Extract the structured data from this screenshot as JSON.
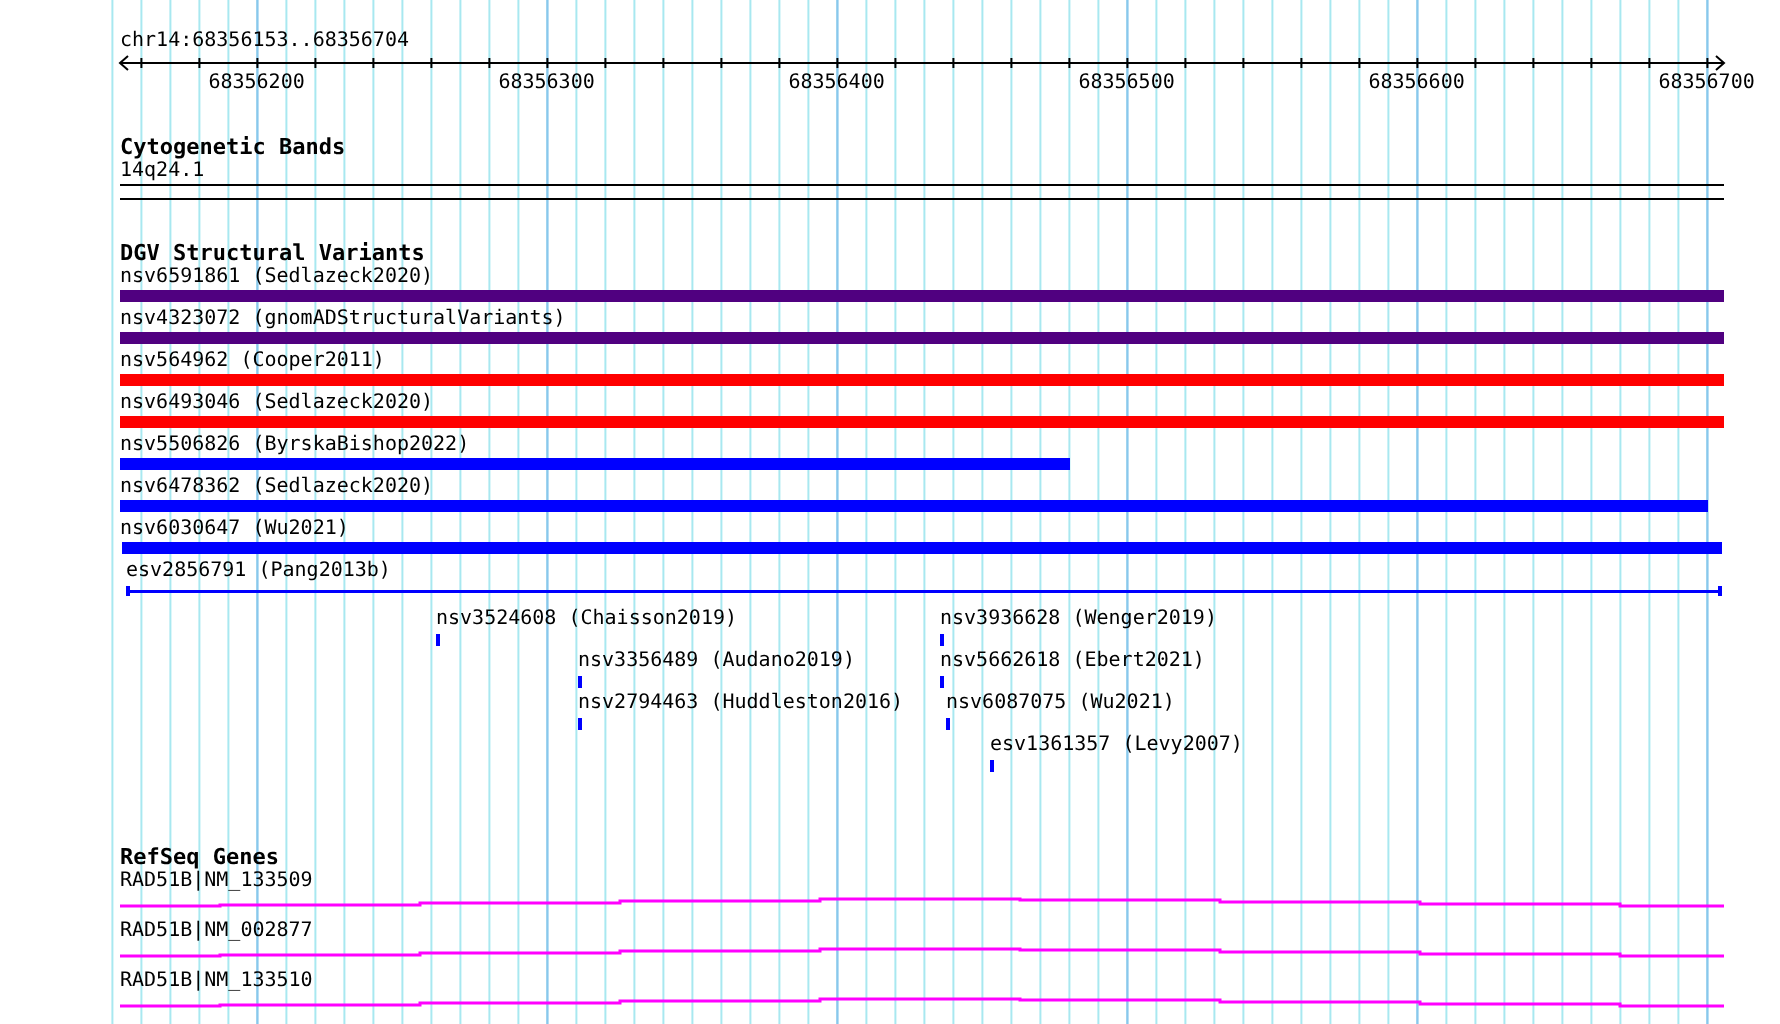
{
  "ruler": {
    "location": "chr14:68356153..68356704",
    "ticks": [
      "68356200",
      "68356300",
      "68356400",
      "68356500",
      "68356600",
      "68356700"
    ]
  },
  "tracks": [
    {
      "kind": "bands",
      "title": "Cytogenetic Bands",
      "features": [
        {
          "label": "14q24.1"
        }
      ]
    },
    {
      "kind": "variants",
      "title": "DGV Structural Variants",
      "features": [
        {
          "kind": "bar",
          "label": "nsv6591861 (Sedlazeck2020)",
          "color": "#500080"
        },
        {
          "kind": "bar",
          "label": "nsv4323072 (gnomADStructuralVariants)",
          "color": "#500080"
        },
        {
          "kind": "bar",
          "label": "nsv564962 (Cooper2011)",
          "color": "#ff0000"
        },
        {
          "kind": "bar",
          "label": "nsv6493046 (Sedlazeck2020)",
          "color": "#ff0000"
        },
        {
          "kind": "bar",
          "label": "nsv5506826 (ByrskaBishop2022)",
          "color": "#0000ff"
        },
        {
          "kind": "bar",
          "label": "nsv6478362 (Sedlazeck2020)",
          "color": "#0000ff"
        },
        {
          "kind": "bar",
          "label": "nsv6030647 (Wu2021)",
          "color": "#0000ff"
        },
        {
          "kind": "line",
          "label": "esv2856791 (Pang2013b)",
          "color": "#0000ff"
        },
        {
          "kind": "tick",
          "label": "nsv3524608 (Chaisson2019)",
          "color": "#0000ff"
        },
        {
          "kind": "tick",
          "label": "nsv3356489 (Audano2019)",
          "color": "#0000ff"
        },
        {
          "kind": "tick",
          "label": "nsv2794463 (Huddleston2016)",
          "color": "#0000ff"
        },
        {
          "kind": "tick",
          "label": "nsv3936628 (Wenger2019)",
          "color": "#0000ff"
        },
        {
          "kind": "tick",
          "label": "nsv5662618 (Ebert2021)",
          "color": "#0000ff"
        },
        {
          "kind": "tick",
          "label": "nsv6087075 (Wu2021)",
          "color": "#0000ff"
        },
        {
          "kind": "tick",
          "label": "esv1361357 (Levy2007)",
          "color": "#0000ff"
        }
      ]
    },
    {
      "kind": "genes",
      "title": "RefSeq Genes",
      "features": [
        {
          "label": "RAD51B|NM_133509"
        },
        {
          "label": "RAD51B|NM_002877"
        },
        {
          "label": "RAD51B|NM_133510"
        }
      ]
    }
  ]
}
